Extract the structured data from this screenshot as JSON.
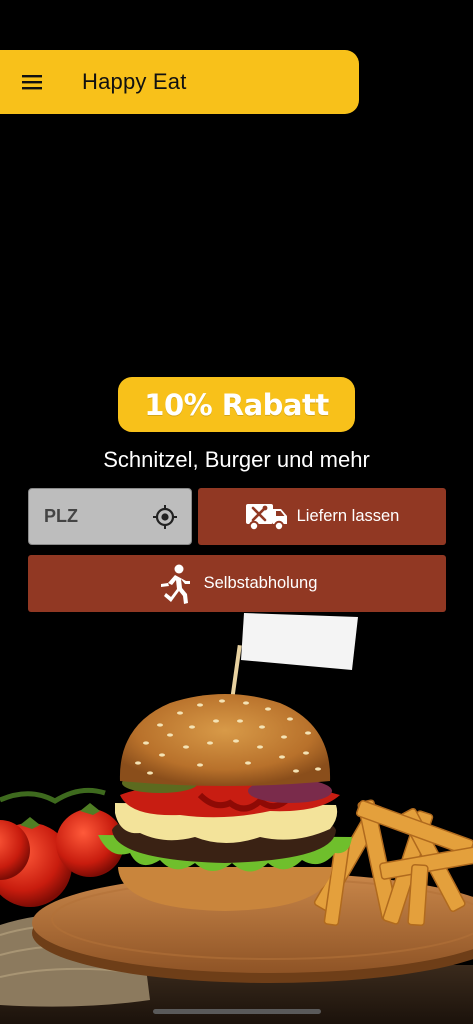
{
  "app_bar": {
    "title": "Happy Eat",
    "menu_icon": "hamburger-menu-icon",
    "color": "#F8C11A"
  },
  "promo": {
    "badge_text": "10% Rabatt",
    "tagline": "Schnitzel, Burger und mehr"
  },
  "order": {
    "plz_placeholder": "PLZ",
    "plz_value": "",
    "locate_icon": "gps-target-icon",
    "deliver_label": "Liefern lassen",
    "deliver_icon": "delivery-truck-icon",
    "pickup_label": "Selbstabholung",
    "pickup_icon": "running-person-icon",
    "button_color": "#913823"
  },
  "hero_image": {
    "icon": "burger-illustration"
  }
}
